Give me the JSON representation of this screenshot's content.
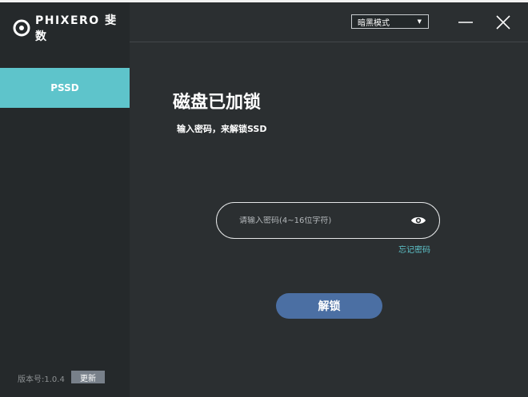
{
  "app": {
    "logo_text": "PHIXERO 斐数",
    "logo_icon": "phixero-logo-icon"
  },
  "sidebar": {
    "items": [
      {
        "label": "PSSD",
        "active": true
      }
    ],
    "version_label": "版本号:1.0.4",
    "update_label": "更新"
  },
  "titlebar": {
    "mode_select": {
      "selected": "暗黑模式"
    },
    "minimize_icon": "minimize-icon",
    "close_icon": "close-icon"
  },
  "main": {
    "title": "磁盘已加锁",
    "subtitle": "输入密码，来解锁SSD",
    "password": {
      "placeholder": "请输入密码(4~16位字符)",
      "value": "",
      "toggle_icon": "eye-icon"
    },
    "forgot_label": "忘记密码",
    "unlock_label": "解锁"
  },
  "colors": {
    "accent": "#5ec4cb",
    "primary_button": "#4b6fa3",
    "sidebar_bg": "#25292b",
    "main_bg": "#2b2f31"
  }
}
